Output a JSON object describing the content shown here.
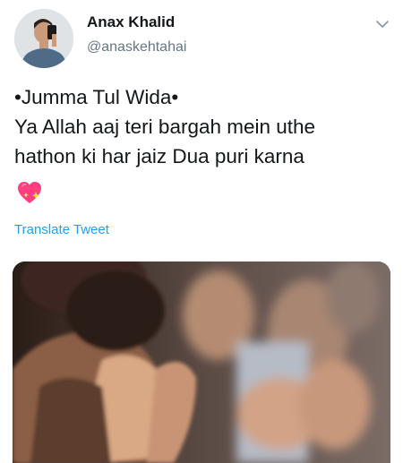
{
  "author": {
    "name": "Anax Khalid",
    "handle": "@anaskehtahai"
  },
  "tweet": {
    "lines": [
      "•Jumma Tul Wida•",
      "Ya Allah aaj teri bargah mein uthe",
      "hathon ki har jaiz Dua puri karna"
    ],
    "emoji": "sparkling-heart-icon"
  },
  "translate_label": "Translate Tweet",
  "colors": {
    "link": "#1da1f2",
    "handle": "#657786",
    "text": "#14171a"
  }
}
